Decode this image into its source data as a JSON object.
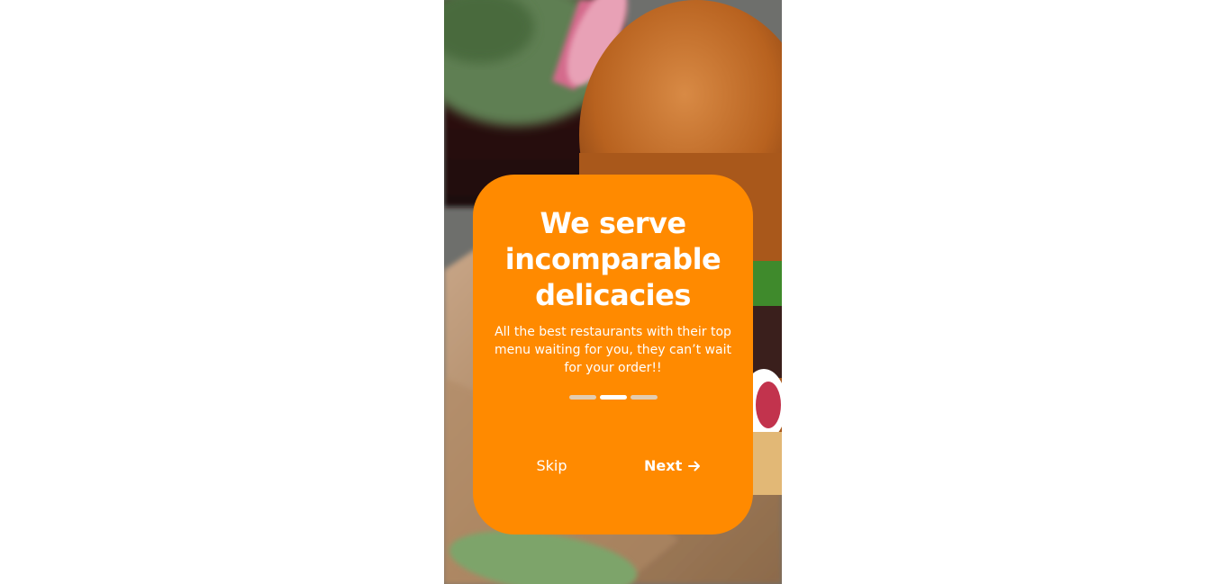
{
  "onboarding": {
    "title": "We serve incomparable delicacies",
    "subtitle": "All the best restaurants with their top menu waiting for you, they can’t wait for your order!!",
    "page_indicator": {
      "total": 3,
      "active": 2
    },
    "skip_label": "Skip",
    "next_label": "Next",
    "next_icon": "arrow-right-icon"
  },
  "background": {
    "image": "burger-photo",
    "card_color": "#ff8a00"
  }
}
